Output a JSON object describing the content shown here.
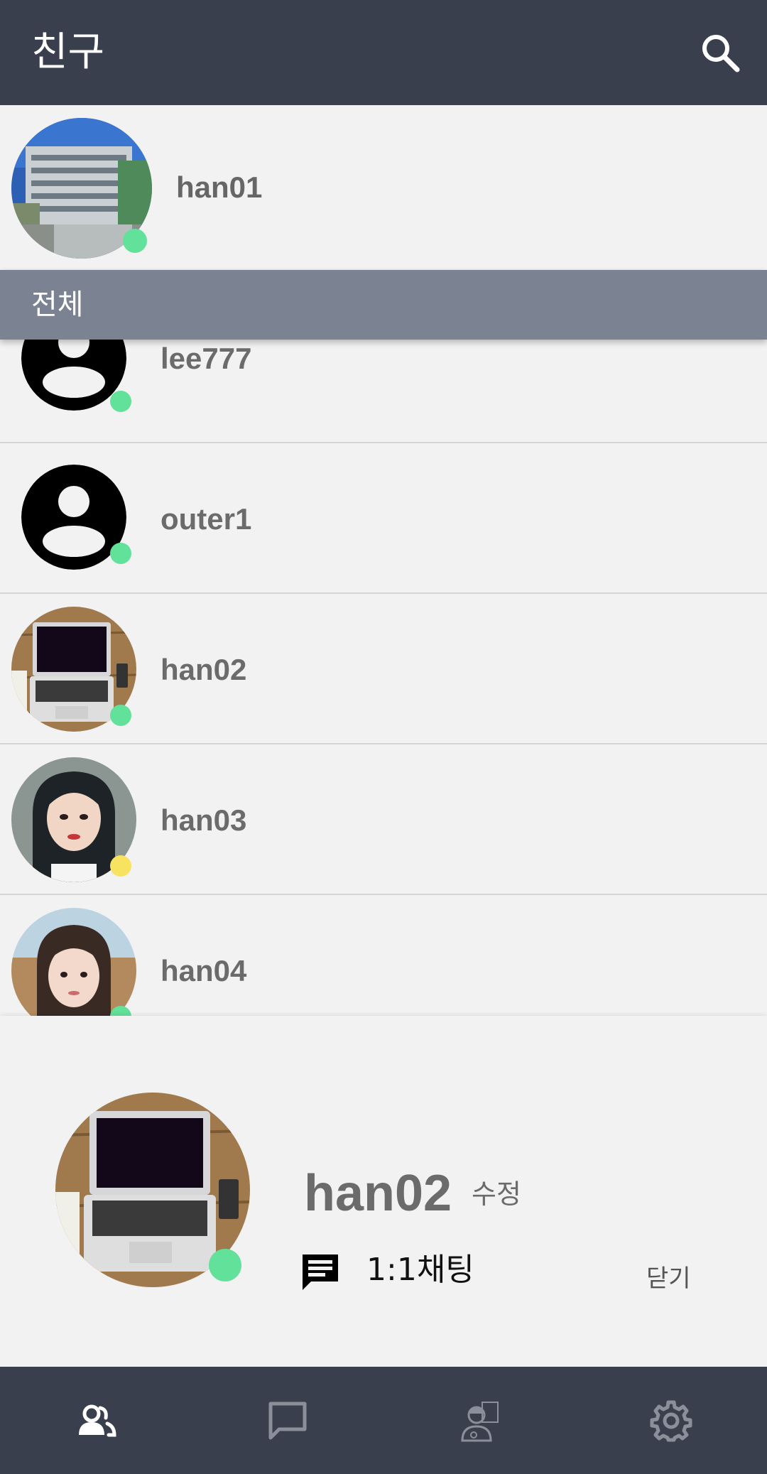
{
  "appbar": {
    "title": "친구",
    "search_icon": "search-icon"
  },
  "me": {
    "name": "han01",
    "status": "online",
    "status_color": "#62e19b"
  },
  "section": {
    "label": "전체"
  },
  "friends": [
    {
      "name": "lee777",
      "status": "online",
      "status_color": "#62e19b",
      "avatar": "default"
    },
    {
      "name": "outer1",
      "status": "online",
      "status_color": "#62e19b",
      "avatar": "default"
    },
    {
      "name": "han02",
      "status": "online",
      "status_color": "#62e19b",
      "avatar": "laptop"
    },
    {
      "name": "han03",
      "status": "away",
      "status_color": "#f7e35f",
      "avatar": "person"
    },
    {
      "name": "han04",
      "status": "online",
      "status_color": "#62e19b",
      "avatar": "person"
    }
  ],
  "sheet": {
    "name": "han02",
    "edit_label": "수정",
    "chat_label": "1:1채팅",
    "close_label": "닫기",
    "chat_icon": "chat-bubble-icon"
  },
  "bottom_nav": [
    {
      "icon": "friends-icon",
      "active": true
    },
    {
      "icon": "chat-icon",
      "active": false
    },
    {
      "icon": "contacts-icon",
      "active": false
    },
    {
      "icon": "settings-icon",
      "active": false
    }
  ],
  "colors": {
    "bar": "#3a3f4e",
    "section": "#7b8393",
    "online": "#62e19b",
    "away": "#f7e35f"
  }
}
